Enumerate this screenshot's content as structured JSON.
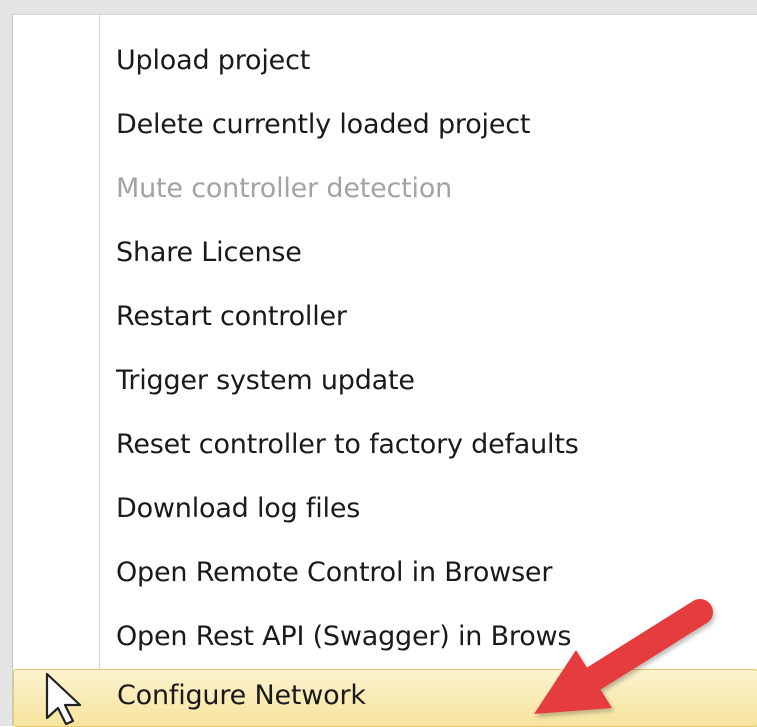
{
  "menu": {
    "items": [
      {
        "label": "Upload project",
        "state": "enabled"
      },
      {
        "label": "Delete currently loaded project",
        "state": "enabled"
      },
      {
        "label": "Mute controller detection",
        "state": "disabled"
      },
      {
        "label": "Share License",
        "state": "enabled"
      },
      {
        "label": "Restart controller",
        "state": "enabled"
      },
      {
        "label": "Trigger system update",
        "state": "enabled"
      },
      {
        "label": "Reset controller to factory defaults",
        "state": "enabled"
      },
      {
        "label": "Download log files",
        "state": "enabled"
      },
      {
        "label": "Open Remote Control in Browser",
        "state": "enabled"
      },
      {
        "label": "Open Rest API (Swagger) in Brows",
        "state": "enabled"
      },
      {
        "label": "Configure Network",
        "state": "highlighted"
      }
    ]
  },
  "annotation": {
    "icon": "red-arrow-icon",
    "color": "#e53d3d"
  },
  "cursor": {
    "icon": "mouse-pointer-icon"
  },
  "colors": {
    "highlight": "#f9eab0",
    "disabled_text": "#a3a3a3"
  }
}
